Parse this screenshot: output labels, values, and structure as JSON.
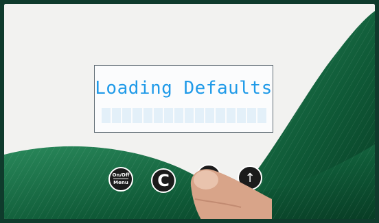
{
  "display": {
    "line1": "Loading Defaults",
    "line2_cells": 16
  },
  "buttons": {
    "onoff_line1": "On/Off",
    "onoff_line2": "Menu",
    "clear_symbol": "C",
    "down_symbol": "↓",
    "up_symbol": "↑"
  },
  "colors": {
    "panel": "#f2f2f0",
    "swirl": "#14613f",
    "lcd_text": "#1f9ae8",
    "button": "#1b1b1b"
  },
  "icons": [
    "up-arrow-icon",
    "down-arrow-icon",
    "clear-icon"
  ]
}
